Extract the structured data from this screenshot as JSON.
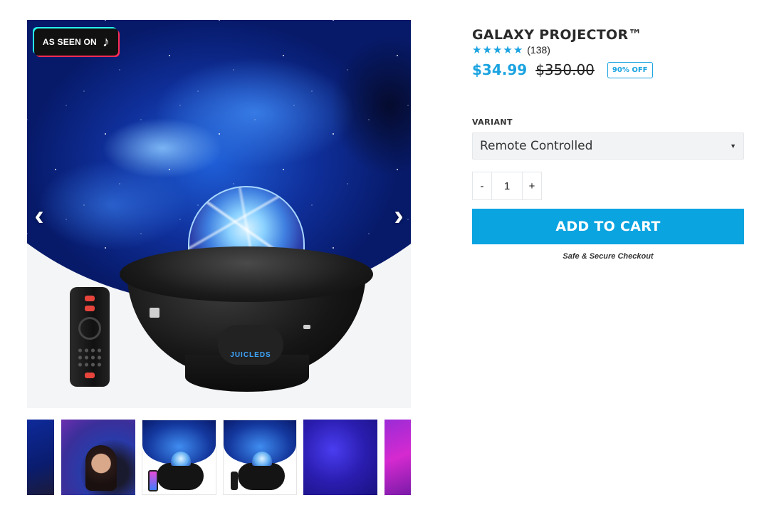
{
  "gallery": {
    "badge_text": "AS SEEN ON",
    "badge_icon": "tiktok-icon",
    "prev_icon": "chevron-left-icon",
    "next_icon": "chevron-right-icon",
    "product_brand": "JUICLEDS",
    "thumbnails_count_visible": 6
  },
  "product": {
    "title": "GALAXY PROJECTOR™",
    "rating": 5,
    "review_count": "(138)",
    "price": "$34.99",
    "compare_price": "$350.00",
    "discount_badge": "90% OFF",
    "variant_label": "VARIANT",
    "variant_selected": "Remote Controlled",
    "quantity": "1",
    "qty_minus": "-",
    "qty_plus": "+",
    "add_to_cart": "ADD TO CART",
    "secure_text": "Safe & Secure Checkout"
  },
  "colors": {
    "accent": "#0aa4e1",
    "price": "#1aa3e0"
  }
}
